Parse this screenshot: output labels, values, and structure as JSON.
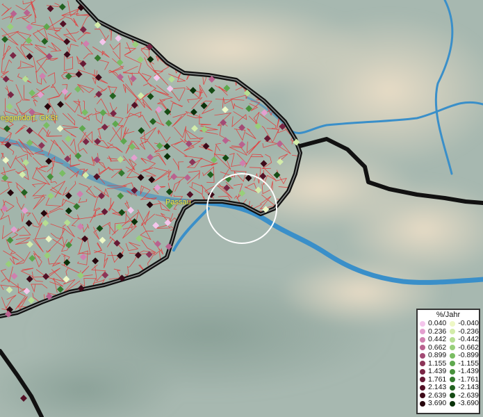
{
  "places": [
    {
      "name": "Deggendorf, GKSt"
    },
    {
      "name": "Passau"
    }
  ],
  "legend": {
    "title": "%/Jahr",
    "positive": [
      {
        "value": "0.040",
        "color": "#f4c6ec"
      },
      {
        "value": "0.236",
        "color": "#e39fcf"
      },
      {
        "value": "0.442",
        "color": "#cf7fae"
      },
      {
        "value": "0.662",
        "color": "#b9628f"
      },
      {
        "value": "0.899",
        "color": "#a24a74"
      },
      {
        "value": "1.155",
        "color": "#8c3558"
      },
      {
        "value": "1.439",
        "color": "#7a2645"
      },
      {
        "value": "1.761",
        "color": "#661a35"
      },
      {
        "value": "2.143",
        "color": "#531126"
      },
      {
        "value": "2.639",
        "color": "#3e0a19"
      },
      {
        "value": "3.690",
        "color": "#26050c"
      }
    ],
    "negative": [
      {
        "value": "-0.040",
        "color": "#eef8c6"
      },
      {
        "value": "-0.236",
        "color": "#d3ecaa"
      },
      {
        "value": "-0.442",
        "color": "#b6de92"
      },
      {
        "value": "-0.662",
        "color": "#98cf7a"
      },
      {
        "value": "-0.899",
        "color": "#7abd63"
      },
      {
        "value": "-1.155",
        "color": "#5ea84e"
      },
      {
        "value": "-1.439",
        "color": "#48913c"
      },
      {
        "value": "-1.761",
        "color": "#357a2e"
      },
      {
        "value": "-2.143",
        "color": "#236220"
      },
      {
        "value": "-2.639",
        "color": "#154b14"
      },
      {
        "value": "-3.690",
        "color": "#0a310a"
      }
    ]
  },
  "colors": {
    "border": "#111111",
    "districts": "#e53a3a",
    "river": "#3a8fc9",
    "highlight_circle": "#ffffff",
    "label": "#f2ea3a"
  }
}
